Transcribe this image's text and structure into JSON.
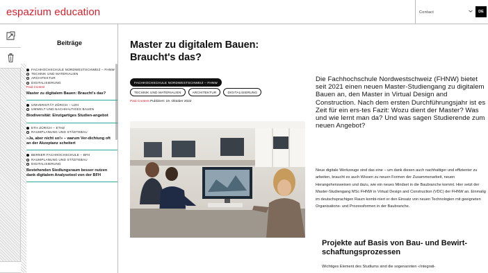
{
  "header": {
    "logo": "espazium education",
    "contact_label": "Contact",
    "language_button": "DE"
  },
  "rail": {
    "tabs": [
      {
        "icon": "collapse-icon"
      },
      {
        "icon": "trash-icon"
      }
    ]
  },
  "sidebar": {
    "title": "Beiträge",
    "items": [
      {
        "tags": [
          "FACHHOCHSCHULE NORDWESTSCHWEIZ – FHNW",
          "TECHNIK UND MATERIALIEN",
          "ARCHITEKTUR",
          "DIGITALISIERUNG"
        ],
        "paid": "Paid Content",
        "title": "Master zu digitalem Bauen: Braucht's das?"
      },
      {
        "tags": [
          "UNIVERSITÄT ZÜRICH – UZH",
          "UMWELT UND NACHHALTIGES BAUEN"
        ],
        "paid": "",
        "title": "Biodiversität: Einzigartiges Studien-angebot"
      },
      {
        "tags": [
          "ETH ZÜRICH – ETHZ",
          "RAUMPLANUNG UND STÄDTEBAU"
        ],
        "paid": "",
        "title": "«Ja, aber nicht so!» – warum Ver-dichtung oft an der Akzeptanz scheitert"
      },
      {
        "tags": [
          "BERNER FACHHOCHSCHULE – BFH",
          "RAUMPLANUNG UND STÄDTEBAU",
          "DIGITALISIERUNG"
        ],
        "paid": "",
        "title": "Bestehenden Siedlungsraum besser nutzen dank digitalem Analysetool von der BFH"
      }
    ]
  },
  "article": {
    "title": "Master zu digitalem Bauen: Braucht's das?",
    "institution_tag": "FACHHOCHSCHULE NORDWESTSCHWEIZ – FHNW",
    "topic_tags": [
      "TECHNIK UND MATERIALIEN",
      "ARCHITEKTUR",
      "DIGITALISIERUNG"
    ],
    "paid_label": "Paid Content",
    "published": "Publiziert: 19. Oktober 2022",
    "lead": "Die Fachhochschule Nordwestschweiz (FHNW) bietet seit 2021 einen neuen Master-Studiengang zu digitalem Bauen an, den Master in Virtual Design and Construction. Nach dem ersten Durchführungsjahr ist es Zeit für ein ers-tes Fazit: Wozu dient der Master? Was und wie lernt man da? Und was sagen Studierende zum neuen Angebot?",
    "body": "Neue digitale Werkzeuge sind das eine – um dank diesen auch nachhaltiger und effizienter zu arbeiten, braucht es auch Wissen zu neuen Formen der Zusammenarbeit, neuen Herangehensweisen und dazu, wie ein neues Mindset in die Baubranche kommt. Hier setzt der Master-Studiengang MSc FHNW in Virtual Design and Construction (VDC) der FHNW an. Einmalig im deutschsprachigen Raum kombi-niert er den Einsatz von neuen Technologien mit geeigneten Organisations- und Prozessformen in der Baubranche.",
    "subhead": "Projekte auf Basis von Bau- und Bewirt-schaftungsprozessen",
    "body2": "Wichtiges Element des Studiums sind die sogenannten «Integrati-"
  },
  "colors": {
    "brand_red": "#d8202e",
    "accent_teal": "#2aa69a"
  }
}
